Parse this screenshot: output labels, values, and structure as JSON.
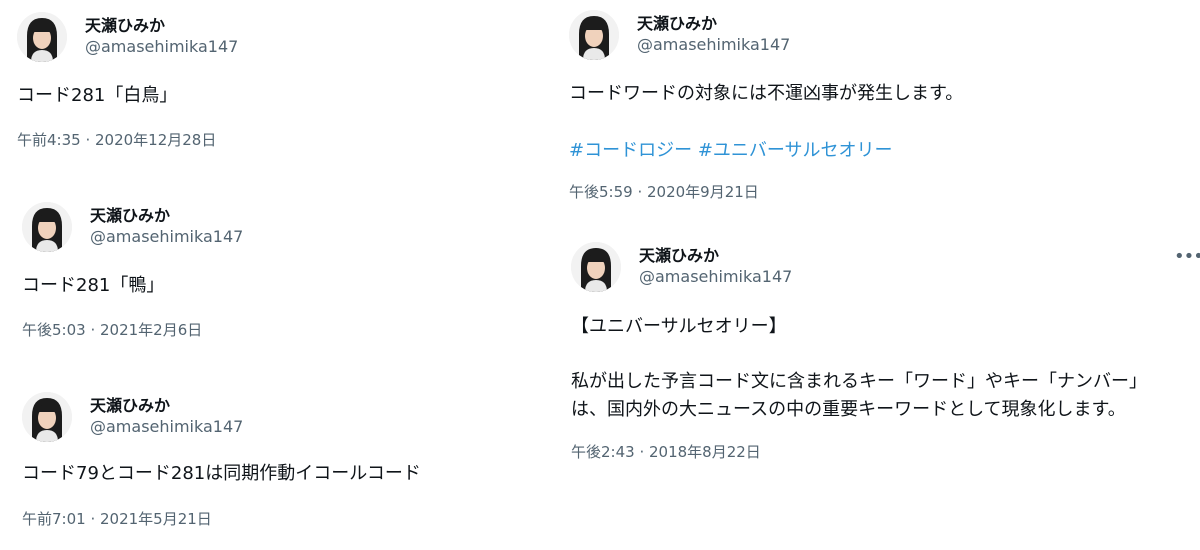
{
  "tweets": [
    {
      "display_name": "天瀬ひみか",
      "handle": "@amasehimika147",
      "text": "コード281「白鳥」",
      "time": "午前4:35 · 2020年12月28日"
    },
    {
      "display_name": "天瀬ひみか",
      "handle": "@amasehimika147",
      "text": "コード281「鴨」",
      "time": "午後5:03 · 2021年2月6日"
    },
    {
      "display_name": "天瀬ひみか",
      "handle": "@amasehimika147",
      "text": "コード79とコード281は同期作動イコールコード",
      "time": "午前7:01 · 2021年5月21日"
    },
    {
      "display_name": "天瀬ひみか",
      "handle": "@amasehimika147",
      "text": "コードワードの対象には不運凶事が発生します。",
      "hashtags": [
        "#コードロジー",
        "#ユニバーサルセオリー"
      ],
      "time": "午後5:59 · 2020年9月21日"
    },
    {
      "display_name": "天瀬ひみか",
      "handle": "@amasehimika147",
      "text_lines": [
        "【ユニバーサルセオリー】",
        "私が出した予言コード文に含まれるキー「ワード」やキー「ナンバー」",
        "は、国内外の大ニュースの中の重要キーワードとして現象化します。"
      ],
      "time": "午後2:43 · 2018年8月22日",
      "more_icon": "more-horizontal-icon"
    }
  ],
  "colors": {
    "text": "#0f1419",
    "secondary": "#536471",
    "hashtag": "#2f93d6"
  }
}
